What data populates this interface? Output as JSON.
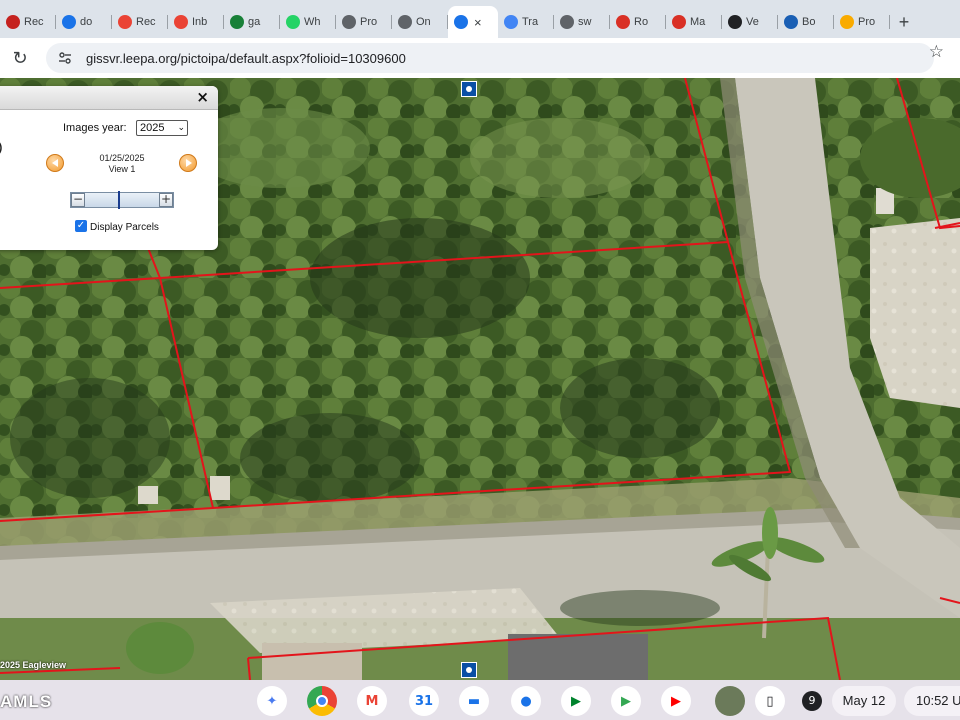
{
  "browser": {
    "tabs": [
      {
        "label": "Rec",
        "icon": "realtor-icon",
        "color": "#c5221f"
      },
      {
        "label": "do",
        "icon": "clock-icon",
        "color": "#1a73e8"
      },
      {
        "label": "Rec",
        "icon": "gmail-icon",
        "color": "#ea4335"
      },
      {
        "label": "Inb",
        "icon": "gmail-icon",
        "color": "#ea4335"
      },
      {
        "label": "ga",
        "icon": "sheets-icon",
        "color": "#188038"
      },
      {
        "label": "Wh",
        "icon": "whatsapp-icon",
        "color": "#25d366"
      },
      {
        "label": "Pro",
        "icon": "globe-icon",
        "color": "#5f6368"
      },
      {
        "label": "On",
        "icon": "globe-icon",
        "color": "#5f6368"
      },
      {
        "label": "",
        "icon": "globe-icon",
        "color": "#1a73e8",
        "active": true
      },
      {
        "label": "Tra",
        "icon": "translate-icon",
        "color": "#4285f4"
      },
      {
        "label": "sw",
        "icon": "globe-icon",
        "color": "#5f6368"
      },
      {
        "label": "Ro",
        "icon": "c-icon",
        "color": "#d93025"
      },
      {
        "label": "Ma",
        "icon": "c-icon",
        "color": "#d93025"
      },
      {
        "label": "Ve",
        "icon": "openai-icon",
        "color": "#202124"
      },
      {
        "label": "Bo",
        "icon": "moon-icon",
        "color": "#1a5fb4"
      },
      {
        "label": "Pro",
        "icon": "cone-icon",
        "color": "#f9ab00"
      }
    ],
    "close_glyph": "×",
    "new_tab_glyph": "+",
    "url": "gissvr.leepa.org/pictoipa/default.aspx?folioid=10309600"
  },
  "panel": {
    "images_year_label": "Images year:",
    "year_value": "2025",
    "image_date": "01/25/2025",
    "image_view": "View 1",
    "zoom_out_glyph": "−",
    "zoom_in_glyph": "+",
    "display_parcels_label": "Display Parcels",
    "display_parcels_checked": true,
    "close_glyph": "×"
  },
  "map": {
    "copyright": "2025 Eagleview"
  },
  "watermark": "AMLS",
  "shelf": {
    "apps": [
      {
        "name": "gemini-icon",
        "glyph": "✦",
        "bg": "#ffffff",
        "fg": "#4a7bf0"
      },
      {
        "name": "chrome-icon",
        "glyph": "",
        "bg": "#ffffff",
        "fg": "#ea4335"
      },
      {
        "name": "gmail-icon",
        "glyph": "M",
        "bg": "#ffffff",
        "fg": "#ea4335"
      },
      {
        "name": "calendar-icon",
        "glyph": "31",
        "bg": "#ffffff",
        "fg": "#1a73e8"
      },
      {
        "name": "files-icon",
        "glyph": "▬",
        "bg": "#ffffff",
        "fg": "#1a73e8"
      },
      {
        "name": "messages-icon",
        "glyph": "●",
        "bg": "#ffffff",
        "fg": "#1a73e8"
      },
      {
        "name": "meet-icon",
        "glyph": "▶",
        "bg": "#ffffff",
        "fg": "#00832d"
      },
      {
        "name": "play-store-icon",
        "glyph": "▶",
        "bg": "#ffffff",
        "fg": "#34a853"
      },
      {
        "name": "youtube-icon",
        "glyph": "▶",
        "bg": "#ffffff",
        "fg": "#ff0000"
      },
      {
        "name": "photo-thumbnail-icon",
        "glyph": "",
        "bg": "#6b7a5a",
        "fg": "#ffffff"
      },
      {
        "name": "phone-hub-icon",
        "glyph": "▯",
        "bg": "#ffffff",
        "fg": "#202124"
      }
    ],
    "notification_count": "9",
    "date": "May 12",
    "time": "10:52 U"
  }
}
